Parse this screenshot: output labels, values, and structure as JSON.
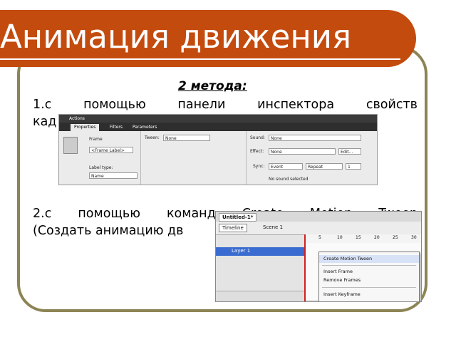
{
  "slide": {
    "title": "Анимация движения",
    "subtitle": "2 метода:",
    "p1_line1": "1.с помощью панели инспектора свойств",
    "p1_line2": "кад",
    "p2_line1": "2.с помощью команд   Create Motion Tween",
    "p2_line2": "(Создать анимацию дв"
  },
  "props_panel": {
    "actions": "Actions",
    "tabs": [
      "Properties",
      "Filters",
      "Parameters"
    ],
    "frame_label": "Frame",
    "frame_name": "<Frame Label>",
    "label_type": "Label type:",
    "label_type_value": "Name",
    "tween_label": "Tween:",
    "tween_value": "None",
    "sound_label": "Sound:",
    "sound_value": "None",
    "effect_label": "Effect:",
    "effect_value": "None",
    "edit_label": "Edit...",
    "sync_label": "Sync:",
    "sync_value": "Event",
    "repeat_value": "Repeat",
    "repeat_count": "1",
    "no_sound": "No sound selected"
  },
  "timeline": {
    "tab": "Untitled-1*",
    "timeline_button": "Timeline",
    "scene": "Scene 1",
    "ticks": [
      "5",
      "10",
      "15",
      "20",
      "25",
      "30"
    ],
    "layer": "Layer 1",
    "menu": [
      "Create Motion Tween",
      "Insert Frame",
      "Remove Frames",
      "Insert Keyframe"
    ]
  },
  "colors": {
    "title_bg": "#c44b0e",
    "frame_border": "#8c8454"
  }
}
